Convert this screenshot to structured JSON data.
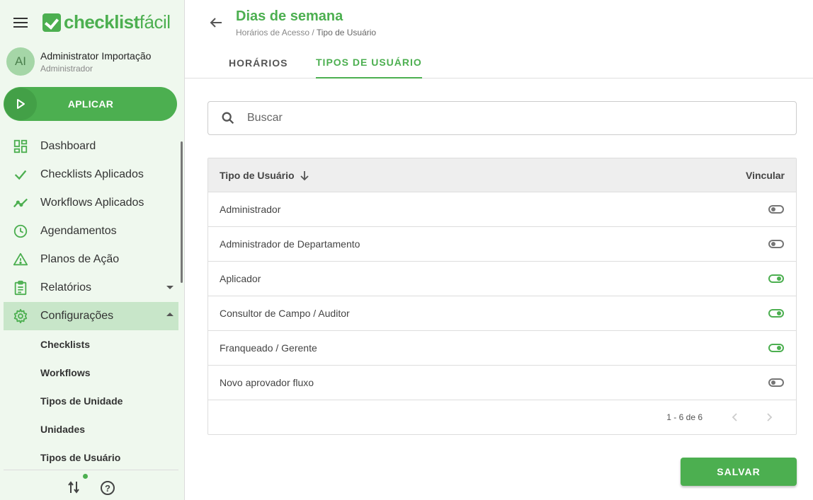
{
  "brand": {
    "name_bold": "checklist",
    "name_light": "fácil",
    "accent": "#4caf50"
  },
  "user": {
    "initials": "AI",
    "name": "Administrator Importação",
    "role": "Administrador"
  },
  "apply_label": "APLICAR",
  "nav": {
    "items": [
      {
        "label": "Dashboard",
        "icon": "dashboard-icon"
      },
      {
        "label": "Checklists Aplicados",
        "icon": "check-icon"
      },
      {
        "label": "Workflows Aplicados",
        "icon": "trend-icon"
      },
      {
        "label": "Agendamentos",
        "icon": "clock-icon"
      },
      {
        "label": "Planos de Ação",
        "icon": "warning-icon"
      },
      {
        "label": "Relatórios",
        "icon": "clipboard-icon"
      },
      {
        "label": "Configurações",
        "icon": "gear-icon"
      }
    ],
    "sub_items": [
      "Checklists",
      "Workflows",
      "Tipos de Unidade",
      "Unidades",
      "Tipos de Usuário"
    ]
  },
  "header": {
    "title": "Dias de semana",
    "breadcrumb_parent": "Horários de Acesso /",
    "breadcrumb_current": "Tipo de Usuário"
  },
  "tabs": [
    {
      "label": "HORÁRIOS",
      "active": false
    },
    {
      "label": "TIPOS DE USUÁRIO",
      "active": true
    }
  ],
  "search": {
    "placeholder": "Buscar"
  },
  "table": {
    "col_type": "Tipo de Usuário",
    "col_link": "Vincular",
    "rows": [
      {
        "label": "Administrador",
        "linked": false
      },
      {
        "label": "Administrador de Departamento",
        "linked": false
      },
      {
        "label": "Aplicador",
        "linked": true
      },
      {
        "label": "Consultor de Campo / Auditor",
        "linked": true
      },
      {
        "label": "Franqueado / Gerente",
        "linked": true
      },
      {
        "label": "Novo aprovador fluxo",
        "linked": false
      }
    ],
    "page_info": "1 - 6 de 6"
  },
  "save_label": "SALVAR"
}
